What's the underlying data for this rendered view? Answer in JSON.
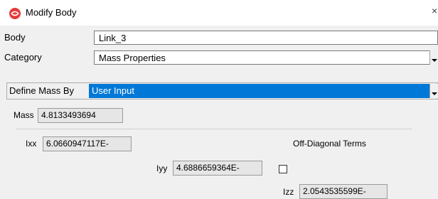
{
  "window": {
    "title": "Modify Body",
    "close_glyph": "×",
    "accent": "#e63a3a"
  },
  "form": {
    "body_label": "Body",
    "body_value": "Link_3",
    "category_label": "Category",
    "category_value": "Mass Properties",
    "define_label": "Define Mass By",
    "define_value": "User Input",
    "selection_color": "#0078d7"
  },
  "mass": {
    "mass_label": "Mass",
    "mass_value": "4.8133493694",
    "ixx_label": "Ixx",
    "ixx_value": "6.0660947117E-",
    "iyy_label": "Iyy",
    "iyy_value": "4.6886659364E-",
    "izz_label": "Izz",
    "izz_value": "2.0543535599E-",
    "offdiag_label": "Off-Diagonal Terms",
    "offdiag_checked": false
  },
  "icons": [
    "app-logo-icon",
    "close-icon",
    "dropdown-arrow-icon",
    "checkbox-icon"
  ]
}
